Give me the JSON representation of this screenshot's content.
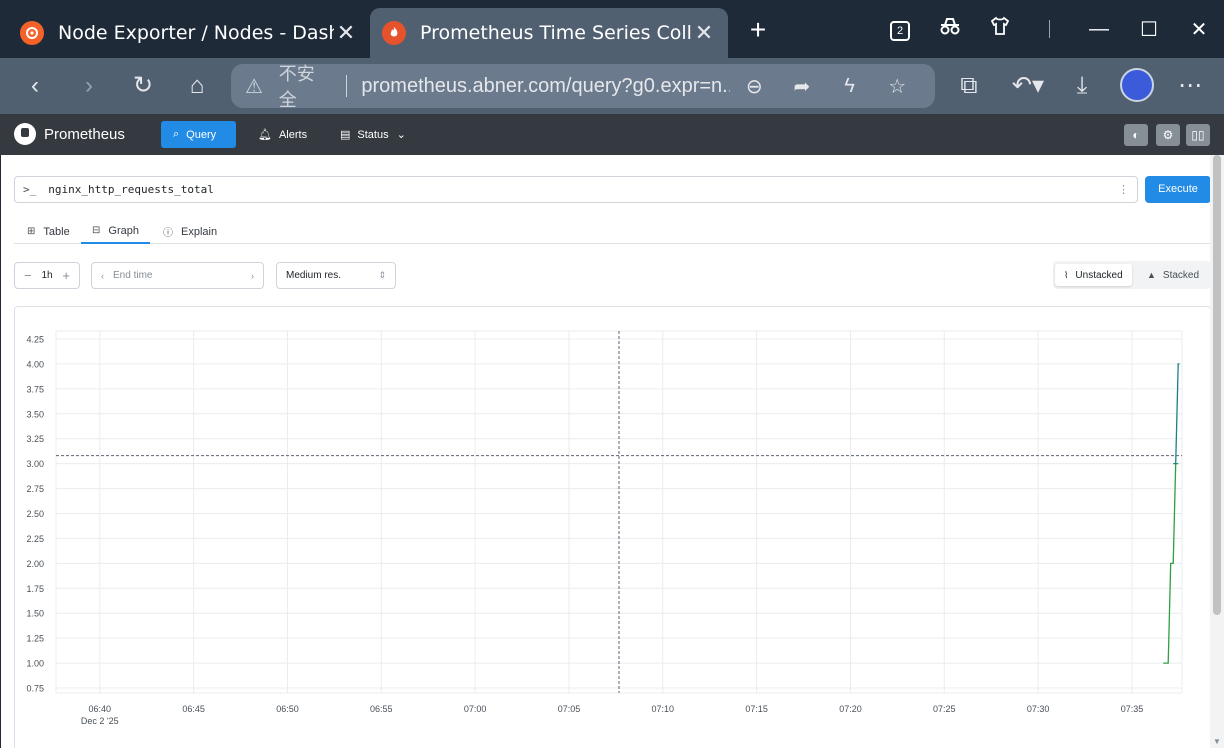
{
  "browser": {
    "tabs": [
      {
        "title": "Node Exporter / Nodes - Dashb",
        "active": false
      },
      {
        "title": "Prometheus Time Series Collect",
        "active": true
      }
    ],
    "tab_count": "2",
    "insecure_label": "不安全",
    "url": "prometheus.abner.com/query?g0.expr=n..."
  },
  "nav": {
    "brand": "Prometheus",
    "items": [
      {
        "label": "Query",
        "icon": "search-icon"
      },
      {
        "label": "Alerts",
        "icon": "bell-icon"
      },
      {
        "label": "Status",
        "icon": "server-icon"
      }
    ]
  },
  "query": {
    "expression": "nginx_http_requests_total",
    "execute_label": "Execute"
  },
  "tabs": [
    {
      "label": "Table",
      "icon": "table-icon"
    },
    {
      "label": "Graph",
      "icon": "graph-icon",
      "active": true
    },
    {
      "label": "Explain",
      "icon": "info-icon"
    }
  ],
  "controls": {
    "range": "1h",
    "end_time_placeholder": "End time",
    "resolution": "Medium res.",
    "unstacked_label": "Unstacked",
    "stacked_label": "Stacked",
    "mode": "unstacked"
  },
  "colors": {
    "accent": "#228be6",
    "series_green": "#2f9e44",
    "series_teal": "#1c7e8a"
  },
  "chart_data": {
    "type": "line",
    "title": "",
    "xlabel": "",
    "ylabel": "",
    "x_ticks": [
      "06:40",
      "06:45",
      "06:50",
      "06:55",
      "07:00",
      "07:05",
      "07:10",
      "07:15",
      "07:20",
      "07:25",
      "07:30",
      "07:35"
    ],
    "x_tick_sublabel": "Dec 2 '25",
    "y_ticks": [
      "0.75",
      "1.00",
      "1.25",
      "1.50",
      "1.75",
      "2.00",
      "2.25",
      "2.50",
      "2.75",
      "3.00",
      "3.25",
      "3.50",
      "3.75",
      "4.00",
      "4.25"
    ],
    "xlim": [
      "06:37:40",
      "07:37:40"
    ],
    "ylim": [
      0.7,
      4.33
    ],
    "grid": true,
    "cursor": {
      "x": "07:07:40",
      "y": 3.08
    },
    "series": [
      {
        "color": "#2f9e44",
        "points": [
          [
            "07:36:40",
            1.0
          ],
          [
            "07:36:56",
            1.0
          ],
          [
            "07:37:04",
            2.0
          ],
          [
            "07:37:12",
            2.0
          ],
          [
            "07:37:20",
            3.0
          ],
          [
            "07:37:28",
            3.0
          ]
        ]
      },
      {
        "color": "#1c7e8a",
        "points": [
          [
            "07:37:12",
            3.0
          ],
          [
            "07:37:20",
            3.0
          ],
          [
            "07:37:28",
            4.0
          ],
          [
            "07:37:32",
            4.0
          ]
        ]
      }
    ]
  }
}
